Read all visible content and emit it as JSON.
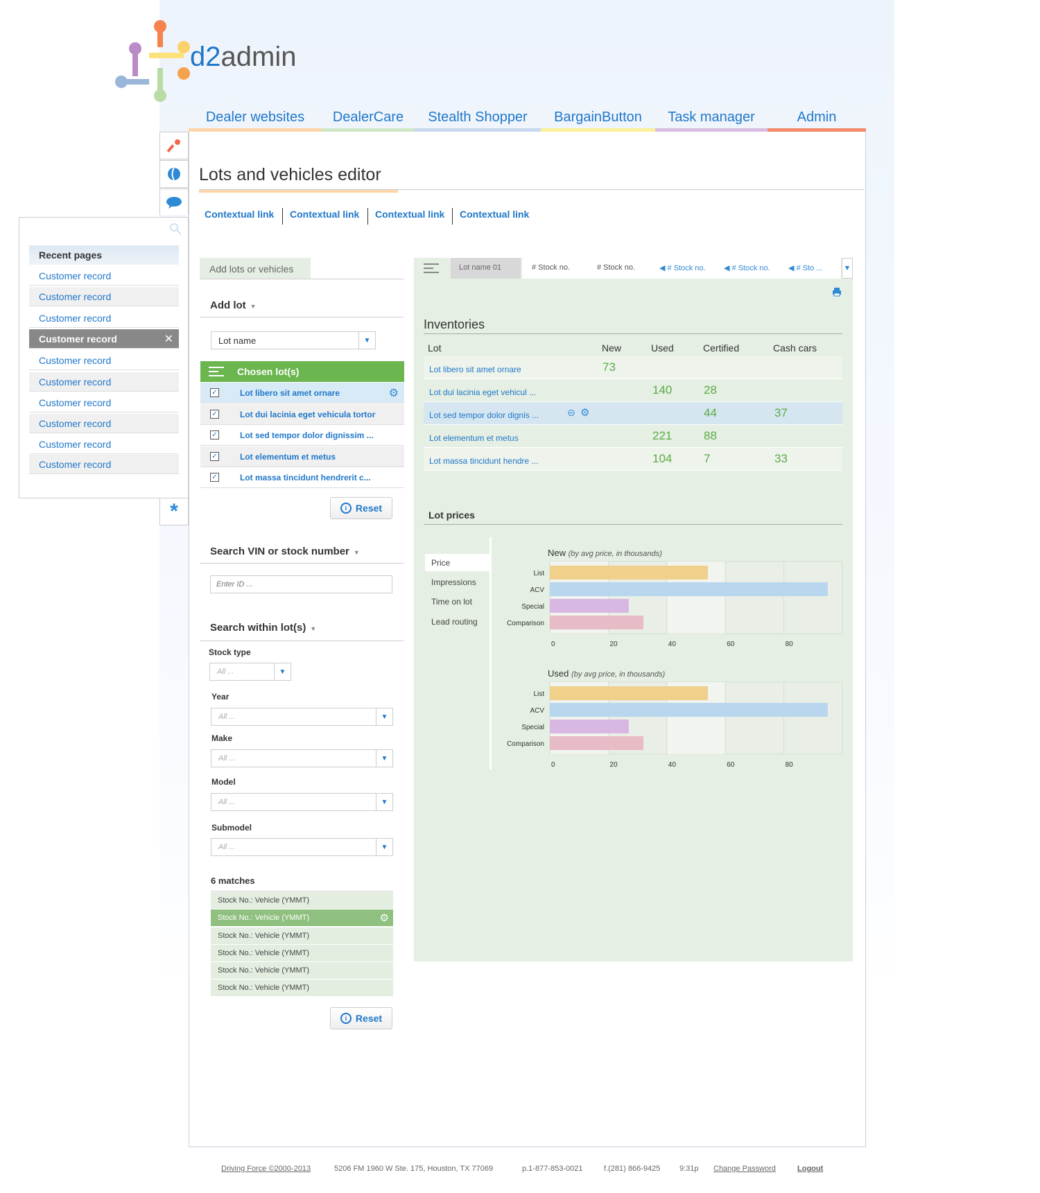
{
  "logo": {
    "part1": "d2",
    "part2": "admin"
  },
  "nav": [
    {
      "label": "Dealer websites",
      "color": "#fcd6aa"
    },
    {
      "label": "DealerCare",
      "color": "#cfe7c7"
    },
    {
      "label": "Stealth Shopper",
      "color": "#c8d9ef"
    },
    {
      "label": "BargainButton",
      "color": "#fbf09c"
    },
    {
      "label": "Task manager",
      "color": "#d9bde3"
    },
    {
      "label": "Admin",
      "color": "#f58a6b"
    }
  ],
  "page_title": "Lots and vehicles editor",
  "contextual_links": [
    "Contextual link",
    "Contextual link",
    "Contextual link",
    "Contextual link"
  ],
  "recent": {
    "title": "Recent pages",
    "items": [
      "Customer record",
      "Customer record",
      "Customer record",
      "Customer record",
      "Customer record",
      "Customer record",
      "Customer record",
      "Customer record",
      "Customer record",
      "Customer record"
    ],
    "selected_index": 3
  },
  "left": {
    "tab_label": "Add lots or vehicles",
    "add_lot_label": "Add lot",
    "lot_select_value": "Lot name",
    "chosen_label": "Chosen lot(s)",
    "lots": [
      "Lot libero sit amet ornare",
      "Lot dui lacinia eget vehicula tortor",
      "Lot sed tempor dolor dignissim  ...",
      "Lot elementum et metus",
      "Lot massa tincidunt hendrerit  c..."
    ],
    "reset_label": "Reset",
    "search_vin_label": "Search VIN or stock number",
    "id_placeholder": "Enter ID ...",
    "search_within_label": "Search within lot(s)",
    "filters": [
      {
        "label": "Stock type",
        "value": "All ..."
      },
      {
        "label": "Year",
        "value": "All ..."
      },
      {
        "label": "Make",
        "value": "All ..."
      },
      {
        "label": "Model",
        "value": "All ..."
      },
      {
        "label": "Submodel",
        "value": "All ..."
      }
    ],
    "matches_label": "6 matches",
    "matches": [
      "Stock No.: Vehicle (YMMT)",
      "Stock No.: Vehicle (YMMT)",
      "Stock No.: Vehicle (YMMT)",
      "Stock No.: Vehicle (YMMT)",
      "Stock No.: Vehicle (YMMT)",
      "Stock No.: Vehicle (YMMT)"
    ],
    "matches_selected": 1,
    "reset2_label": "Reset"
  },
  "right": {
    "tabs": [
      "Lot name 01",
      "# Stock no.",
      "# Stock no.",
      "# Stock no.",
      "# Stock no.",
      "# Sto ..."
    ],
    "inventories_title": "Inventories",
    "inv_headers": [
      "Lot",
      "New",
      "Used",
      "Certified",
      "Cash cars"
    ],
    "inv_rows": [
      {
        "lot": "Lot libero sit amet ornare",
        "new": "73",
        "used": "",
        "certified": "",
        "cash": ""
      },
      {
        "lot": "Lot dui lacinia eget vehicul ...",
        "new": "",
        "used": "140",
        "certified": "28",
        "cash": ""
      },
      {
        "lot": "Lot sed tempor dolor dignis ...",
        "new": "",
        "used": "",
        "certified": "44",
        "cash": "37"
      },
      {
        "lot": "Lot elementum et metus",
        "new": "",
        "used": "221",
        "certified": "88",
        "cash": ""
      },
      {
        "lot": "Lot massa tincidunt hendre ...",
        "new": "",
        "used": "104",
        "certified": "7",
        "cash": "33"
      }
    ],
    "lot_prices_title": "Lot prices",
    "metrics": [
      "Price",
      "Impressions",
      "Time on lot",
      "Lead routing"
    ]
  },
  "chart_data": [
    {
      "type": "bar",
      "title": "New",
      "subtitle": "(by avg price, in thousands)",
      "categories": [
        "List",
        "ACV",
        "Special",
        "Comparison"
      ],
      "values": [
        54,
        95,
        27,
        32
      ],
      "colors": [
        "#f0d08a",
        "#b8d6ee",
        "#d8b8e2",
        "#e8bcc6"
      ],
      "xlim": [
        0,
        100
      ],
      "ticks": [
        0,
        20,
        40,
        60,
        80
      ]
    },
    {
      "type": "bar",
      "title": "Used",
      "subtitle": "(by avg price, in thousands)",
      "categories": [
        "List",
        "ACV",
        "Special",
        "Comparison"
      ],
      "values": [
        54,
        95,
        27,
        32
      ],
      "colors": [
        "#f0d08a",
        "#b8d6ee",
        "#d8b8e2",
        "#e8bcc6"
      ],
      "xlim": [
        0,
        100
      ],
      "ticks": [
        0,
        20,
        40,
        60,
        80
      ]
    }
  ],
  "footer": {
    "copyright": "Driving Force ©2000-2013",
    "address": "5206 FM 1960 W Ste. 175, Houston, TX 77069",
    "phone": "p.1-877-853-0021",
    "fax": "f.(281) 866-9425",
    "time": "9:31p",
    "change_password": "Change Password",
    "logout": "Logout"
  },
  "colors": {
    "accent": "#1f77c9",
    "green": "#6bb64f",
    "panel": "#e5efe3"
  }
}
